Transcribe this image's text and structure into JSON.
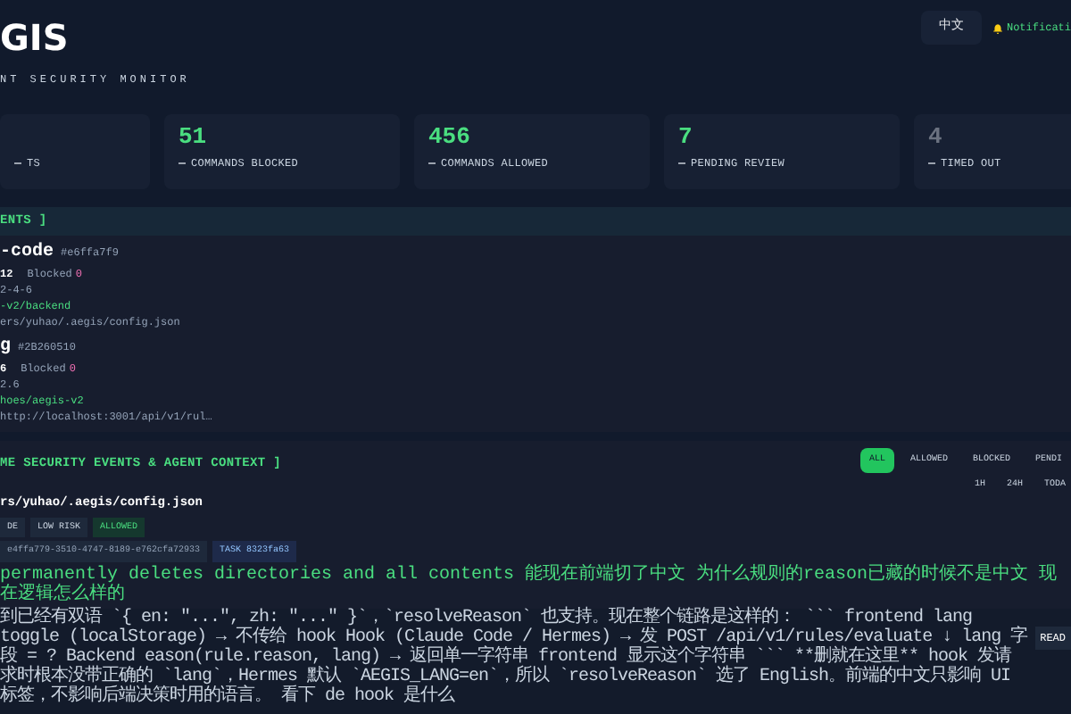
{
  "header": {
    "title": "GIS",
    "subtitle": "NT SECURITY MONITOR",
    "language_button": "中文",
    "notifications_button": "Notificati"
  },
  "stats": [
    {
      "label": "TS"
    },
    {
      "value": "51",
      "label": "COMMANDS BLOCKED",
      "color": "#4ade80"
    },
    {
      "value": "456",
      "label": "COMMANDS ALLOWED",
      "color": "#4ade80"
    },
    {
      "value": "7",
      "label": "PENDING REVIEW",
      "color": "#4ade80"
    },
    {
      "value": "4",
      "label": "TIMED OUT",
      "color": "#6b7280"
    }
  ],
  "agents_panel": {
    "title": "ENTS ]",
    "agents": [
      {
        "name": "-code",
        "id": "#e6ffa7f9",
        "count": "12",
        "blocked_label": "Blocked",
        "blocked": "0",
        "version": "2-4-6",
        "workdir": "-v2/backend",
        "config": "ers/yuhao/.aegis/config.json"
      },
      {
        "name": "g",
        "id": "#2B260510",
        "count": "6",
        "blocked_label": "Blocked",
        "blocked": "0",
        "version": "2.6",
        "workdir": "hoes/aegis-v2",
        "config": "http://localhost:3001/api/v1/rul…"
      }
    ]
  },
  "events_panel": {
    "title": "ME SECURITY EVENTS & AGENT CONTEXT ]",
    "filters": [
      {
        "label": "ALL",
        "selected": true
      },
      {
        "label": "ALLOWED",
        "selected": false
      },
      {
        "label": "BLOCKED",
        "selected": false
      },
      {
        "label": "PENDI",
        "selected": false
      }
    ],
    "ranges": [
      {
        "label": "1H",
        "selected": false
      },
      {
        "label": "24H",
        "selected": false
      },
      {
        "label": "TODA",
        "selected": false
      }
    ],
    "event": {
      "path": "rs/yuhao/.aegis/config.json",
      "tags": [
        {
          "label": "DE",
          "kind": "plain"
        },
        {
          "label": "LOW RISK",
          "kind": "plain"
        },
        {
          "label": "ALLOWED",
          "kind": "allowed"
        }
      ],
      "session": "e4ffa779-3510-4747-8189-e762cfa72933",
      "task": "TASK 8323fa63",
      "reason": "permanently deletes directories and all contents 能现在前端切了中文 为什么规则的reason已藏的时候不是中文 现在逻辑怎么样的",
      "context": "到已经有双语 `{ en: \"...\", zh: \"...\" }`，`resolveReason` 也支持。现在整个链路是这样的： ``` frontend lang toggle (localStorage) → 不传给 hook Hook (Claude Code / Hermes) → 发 POST /api/v1/rules/evaluate ↓ lang 字段 = ? Backend eason(rule.reason, lang) → 返回单一字符串 frontend 显示这个字符串 ``` **删就在这里** hook 发请求时根本没带正确的 `lang`，Hermes 默认 `AEGIS_LANG=en`，所以 `resolveReason` 选了 English。前端的中文只影响 UI 标签，不影响后端决策时用的语言。 看下 de hook 是什么",
      "read_button": "READ"
    }
  }
}
